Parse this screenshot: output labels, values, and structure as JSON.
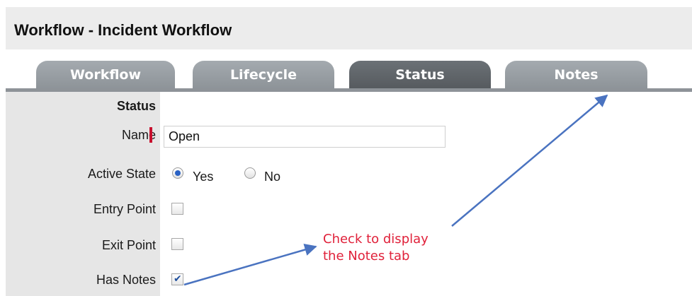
{
  "window": {
    "title": "Workflow - Incident Workflow"
  },
  "tabs": [
    {
      "label": "Workflow",
      "active": false
    },
    {
      "label": "Lifecycle",
      "active": false
    },
    {
      "label": "Status",
      "active": true
    },
    {
      "label": "Notes",
      "active": false
    }
  ],
  "form": {
    "section_label": "Status",
    "name": {
      "label": "Name",
      "value": "Open"
    },
    "active_state": {
      "label": "Active State",
      "options": [
        {
          "label": "Yes",
          "checked": true
        },
        {
          "label": "No",
          "checked": false
        }
      ]
    },
    "entry_point": {
      "label": "Entry Point",
      "checked": false
    },
    "exit_point": {
      "label": "Exit Point",
      "checked": false
    },
    "has_notes": {
      "label": "Has Notes",
      "checked": true
    }
  },
  "annotation": {
    "line1": "Check to display",
    "line2": "the Notes tab",
    "color": "#e0213a",
    "arrow_color": "#4a73c0"
  },
  "colors": {
    "radio_selected": "#2a62c4",
    "required_marker": "#c8102e"
  }
}
